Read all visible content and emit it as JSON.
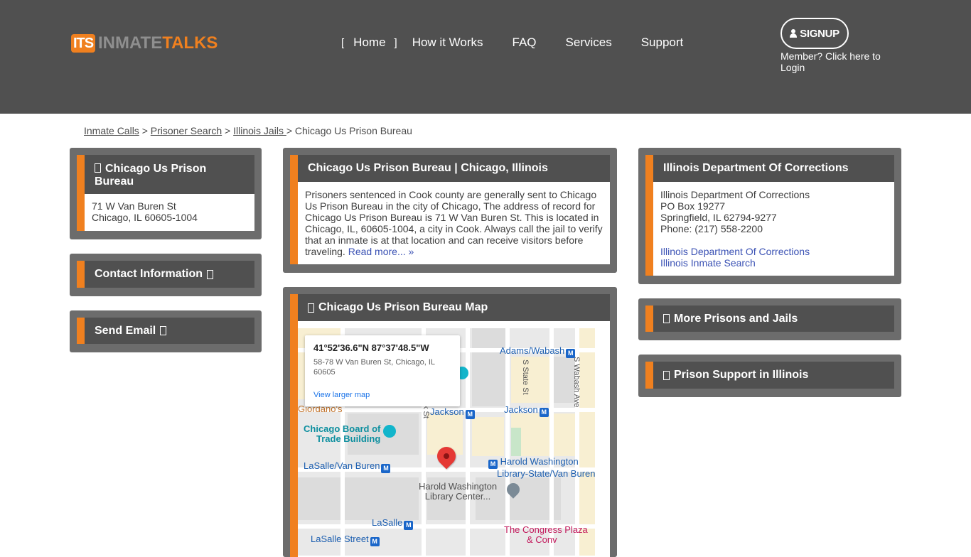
{
  "header": {
    "logo": {
      "badge": "ITS",
      "text_gray": "INMATE",
      "text_orange": "TALKS"
    },
    "nav": {
      "bracket_left": "[",
      "bracket_right": "]",
      "items": [
        "Home",
        "How it Works",
        "FAQ",
        "Services",
        "Support"
      ]
    },
    "signup_label": "SIGNUP",
    "member_link": "Member? Click here to Login"
  },
  "breadcrumb": {
    "items": [
      "Inmate Calls",
      "Prisoner Search",
      "Illinois Jails "
    ],
    "separator": " > ",
    "current": "Chicago Us Prison Bureau"
  },
  "left": {
    "facility_title": "Chicago Us Prison Bureau",
    "address_line1": "71 W Van Buren St",
    "address_line2": "Chicago, IL 60605-1004",
    "contact_title": "Contact Information",
    "send_email_title": "Send Email"
  },
  "center": {
    "title": "Chicago Us Prison Bureau | Chicago, Illinois",
    "description": "Prisoners sentenced in Cook county are generally sent to Chicago Us Prison Bureau in the city of Chicago, The address of record for Chicago Us Prison Bureau is 71 W Van Buren St. This is located in Chicago, IL, 60605-1004, a city in Cook. Always call the jail to verify that an inmate is at that location and can receive visitors before traveling.",
    "read_more": "Read more... »",
    "map_title": "Chicago Us Prison Bureau Map",
    "map": {
      "coord": "41°52'36.6\"N 87°37'48.5\"W",
      "address": "58-78 W Van Buren St, Chicago, IL 60605",
      "view_larger": "View larger map",
      "labels": {
        "adams": "Adams/Wabash",
        "state": "S State St",
        "wabash": "S Wabash Ave",
        "giordanos": "Giordano's",
        "jackson1": "Jackson",
        "jackson2": "Jackson",
        "cbot1": "Chicago Board of",
        "cbot2": "Trade Building",
        "lasalle_vb": "LaSalle/Van Buren",
        "hw1": "Harold Washington",
        "hw2": "Library-State/Van Buren",
        "hwlc1": "Harold Washington",
        "hwlc2": "Library Center...",
        "lasalle": "LaSalle",
        "lasalle_st": "LaSalle Street",
        "congress1": "The Congress Plaza",
        "congress2": "& Conv",
        "kst": "k St",
        "metro_letter": "M"
      }
    }
  },
  "right": {
    "doc_title": "Illinois Department Of Corrections",
    "doc_name": "Illinois Department Of Corrections",
    "doc_po": "PO Box 19277",
    "doc_city": "Springfield, IL 62794-9277",
    "doc_phone": "Phone: (217) 558-2200",
    "doc_link1": "Illinois Department Of Corrections",
    "doc_link2": "Illinois Inmate Search",
    "more_prisons": "More Prisons and Jails",
    "prison_support": "Prison Support in Illinois"
  },
  "colors": {
    "header_bg": "#505050",
    "accent_orange": "#f0801f",
    "panel_gray": "#6c6c6c",
    "link_blue": "#3b52b4"
  }
}
